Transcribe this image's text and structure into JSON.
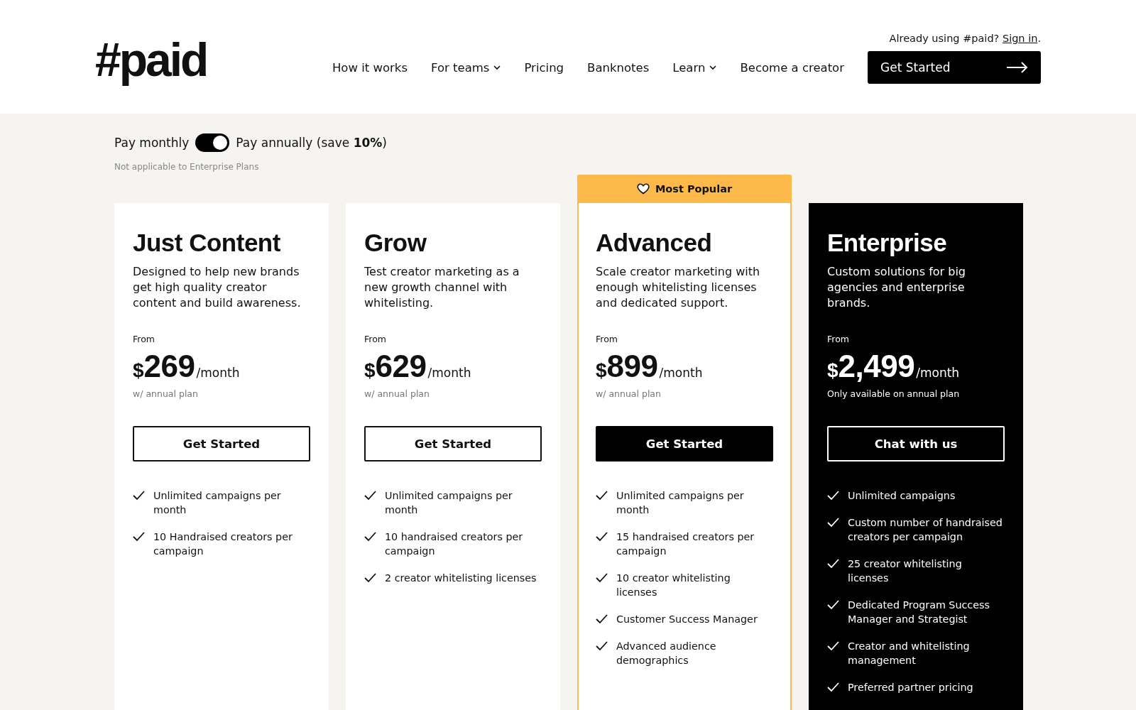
{
  "header": {
    "logo": "#paid",
    "signin_prompt": "Already using #paid?",
    "signin_link": "Sign in",
    "signin_suffix": ".",
    "nav": [
      {
        "label": "How it works",
        "dropdown": false
      },
      {
        "label": "For teams",
        "dropdown": true
      },
      {
        "label": "Pricing",
        "dropdown": false
      },
      {
        "label": "Banknotes",
        "dropdown": false
      },
      {
        "label": "Learn",
        "dropdown": true
      },
      {
        "label": "Become a creator",
        "dropdown": false
      }
    ],
    "cta": "Get Started"
  },
  "billing": {
    "monthly_label": "Pay monthly",
    "annual_label": "Pay annually (save **10%**)",
    "annual_selected": true,
    "note": "Not applicable to Enterprise Plans"
  },
  "plans": [
    {
      "kind": "standard",
      "name": "Just Content",
      "description": "Designed to help new brands get high quality creator content and build awareness.",
      "from": "From",
      "currency": "$",
      "price": "269",
      "period": "/month",
      "note": "w/ annual plan",
      "button": "Get Started",
      "features": [
        "Unlimited campaigns per month",
        "10 Handraised creators per campaign"
      ]
    },
    {
      "kind": "standard",
      "name": "Grow",
      "description": "Test creator marketing as a new growth channel with whitelisting.",
      "from": "From",
      "currency": "$",
      "price": "629",
      "period": "/month",
      "note": "w/ annual plan",
      "button": "Get Started",
      "features": [
        "Unlimited campaigns per month",
        "10 handraised creators per campaign",
        "2 creator whitelisting licenses"
      ]
    },
    {
      "kind": "featured",
      "badge": "Most Popular",
      "name": "Advanced",
      "description": "Scale creator marketing with enough whitelisting licenses and dedicated support.",
      "from": "From",
      "currency": "$",
      "price": "899",
      "period": "/month",
      "note": "w/ annual plan",
      "button": "Get Started",
      "features": [
        "Unlimited campaigns per month",
        "15 handraised creators per campaign",
        "10 creator whitelisting licenses",
        "Customer Success Manager",
        "Advanced audience demographics"
      ]
    },
    {
      "kind": "dark",
      "name": "Enterprise",
      "description": "Custom solutions for big agencies and enterprise brands.",
      "from": "From",
      "currency": "$",
      "price": "2,499",
      "period": "/month",
      "note": "Only available on annual plan",
      "button": "Chat with us",
      "features": [
        "Unlimited campaigns",
        "Custom number of handraised creators per campaign",
        "25 creator whitelisting licenses",
        "Dedicated Program Success Manager and Strategist",
        "Creator and whitelisting management",
        "Preferred partner pricing"
      ]
    }
  ]
}
